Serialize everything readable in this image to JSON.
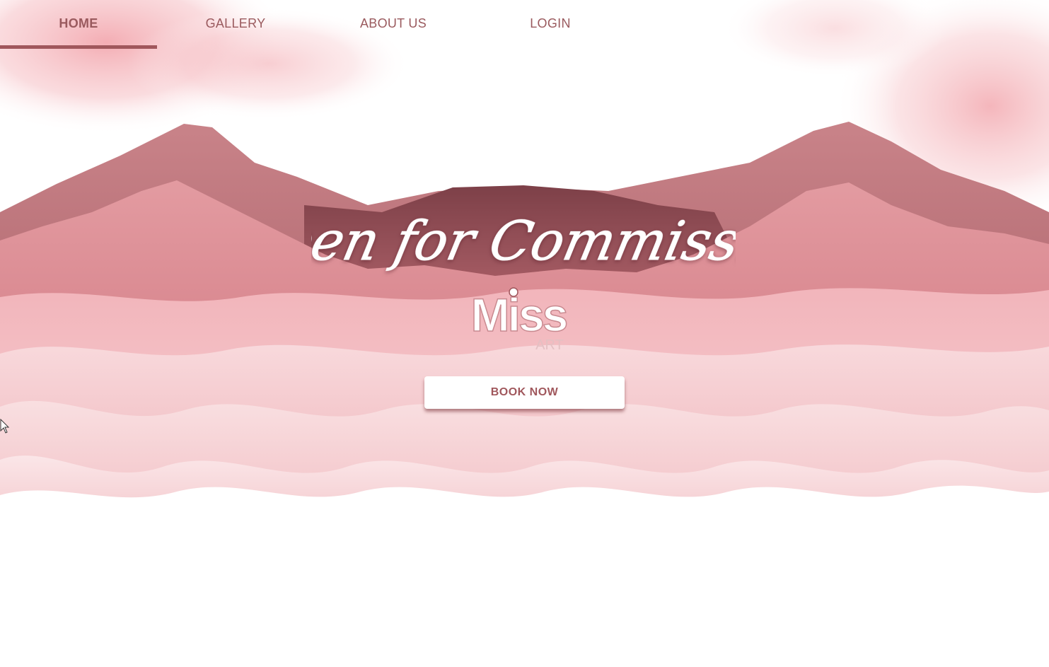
{
  "nav": {
    "items": [
      {
        "label": "HOME",
        "active": true
      },
      {
        "label": "GALLERY",
        "active": false
      },
      {
        "label": "ABOUT US",
        "active": false
      },
      {
        "label": "LOGIN",
        "active": false
      }
    ]
  },
  "hero": {
    "headline": "Open for Commission",
    "logo_text": "Miss",
    "logo_subtext": "ART",
    "cta_label": "BOOK NOW"
  },
  "colors": {
    "accent": "#a0575c",
    "nav_text": "#9a5a5e",
    "mountain_dark": "#8a4a50",
    "mountain_mid": "#d98d94",
    "wave_light": "#f6d6d9"
  },
  "icons": {
    "cursor": "mouse-pointer-icon"
  }
}
